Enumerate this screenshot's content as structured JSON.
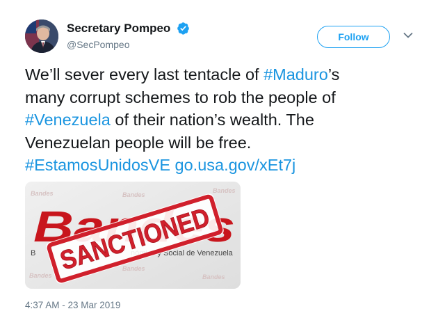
{
  "author": {
    "name": "Secretary Pompeo",
    "handle": "@SecPompeo"
  },
  "follow_label": "Follow",
  "tweet": {
    "line1_pre": "We’ll sever every last tentacle of ",
    "hashtag1": "#Maduro",
    "line1_post": "’s",
    "line2": "many corrupt schemes to rob the people of",
    "hashtag2": "#Venezuela",
    "line3_post": " of their nation’s wealth. The",
    "line4": "Venezuelan people will be free.",
    "hashtag3": "#EstamosUnidosVE",
    "link": "go.usa.gov/xEt7j"
  },
  "media": {
    "logo_watermark": "Bandes",
    "subtitle_fragment": "nómico y Social de Venezuela",
    "subtitle_start": "B",
    "stamp": "SANCTIONED"
  },
  "timestamp": "4:37 AM - 23 Mar 2019",
  "colors": {
    "link": "#1b95e0",
    "follow": "#1da1f2",
    "muted": "#657786",
    "stamp_red": "#d0202c"
  },
  "icons": {
    "verified": "verified-badge-icon",
    "caret": "chevron-down-icon"
  }
}
